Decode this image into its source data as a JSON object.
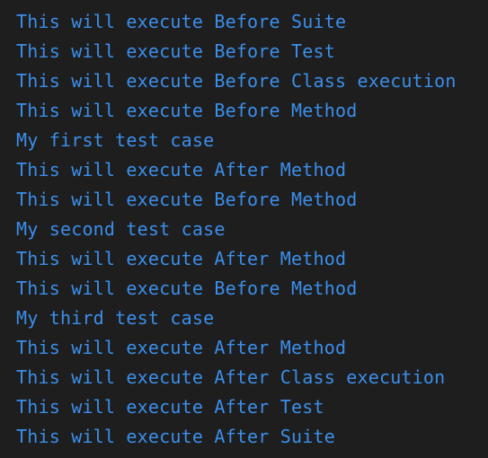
{
  "console": {
    "lines": [
      "This will execute Before Suite",
      "This will execute Before Test",
      "This will execute Before Class execution",
      "This will execute Before Method",
      "My first test case",
      "This will execute After Method",
      "This will execute Before Method",
      "My second test case",
      "This will execute After Method",
      "This will execute Before Method",
      "My third test case",
      "This will execute After Method",
      "This will execute After Class execution",
      "This will execute After Test",
      "This will execute After Suite"
    ],
    "text_color": "#3b8eea",
    "background_color": "#1e1e1e"
  }
}
